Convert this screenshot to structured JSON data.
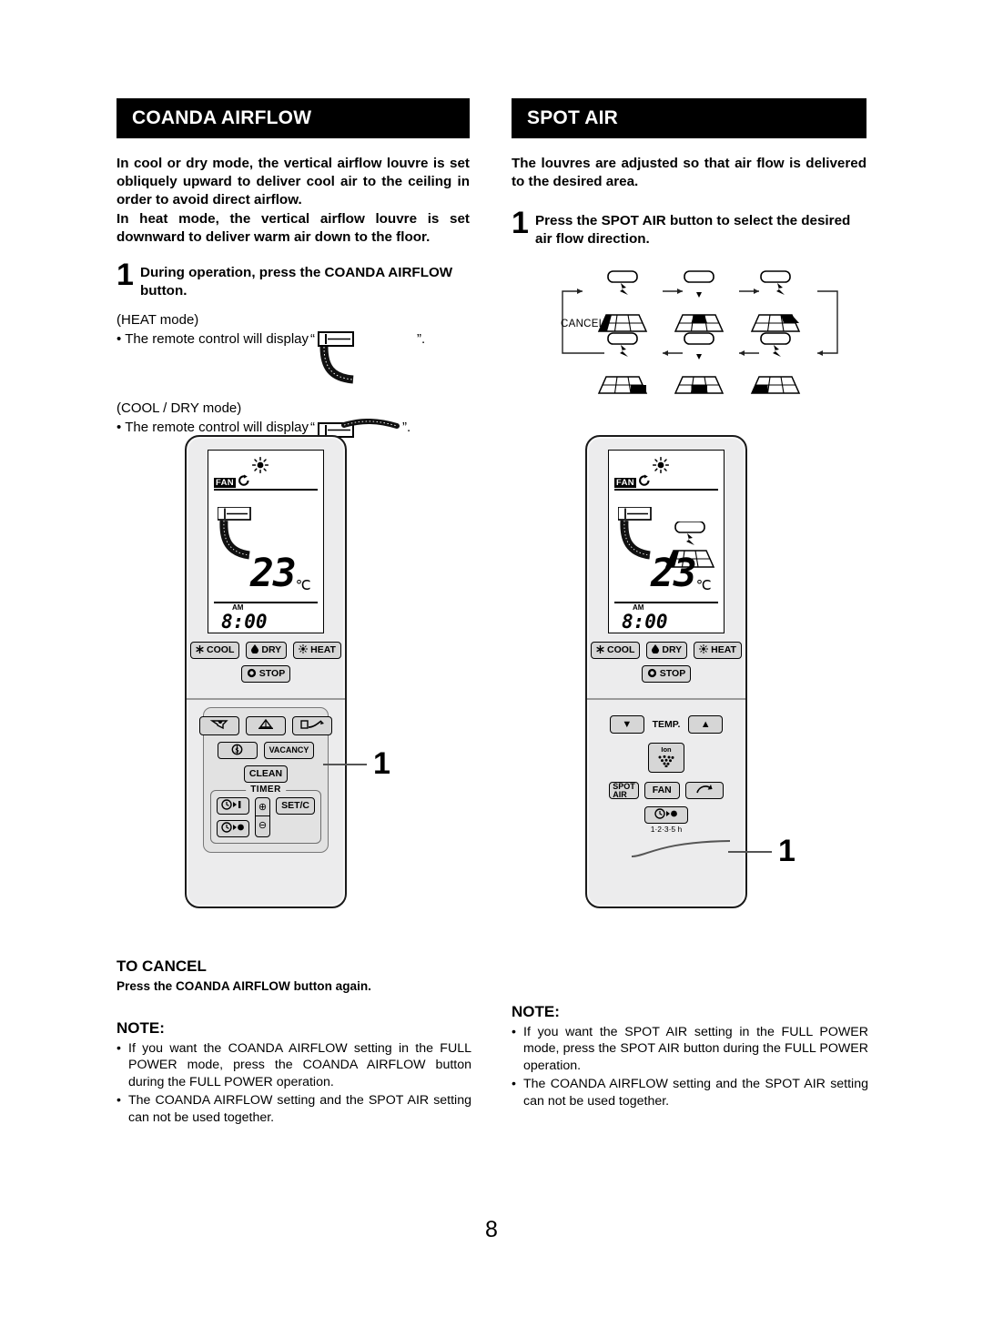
{
  "page": {
    "number": "8"
  },
  "left": {
    "header": "COANDA AIRFLOW",
    "intro": [
      "In cool or dry mode, the vertical airflow louvre is set obliquely upward to deliver cool air to the ceiling in order to avoid direct airflow.",
      "In heat mode, the vertical airflow louvre is set downward to deliver warm air down to the floor."
    ],
    "step": {
      "number": "1",
      "text": "During operation, press the COANDA AIRFLOW button."
    },
    "modes": [
      {
        "label": "(HEAT mode)",
        "bullet": "•",
        "sentence": "The remote control will display",
        "open_quote": "“",
        "close_quote": "”.",
        "icon": "coanda-heat-icon"
      },
      {
        "label": "(COOL / DRY mode)",
        "bullet": "•",
        "sentence": "The remote control will display",
        "open_quote": "“",
        "close_quote": "”.",
        "icon": "coanda-cool-icon"
      }
    ],
    "callout_number": "1",
    "to_cancel": {
      "title": "TO CANCEL",
      "text": "Press the COANDA AIRFLOW button again."
    },
    "note": {
      "title": "NOTE:",
      "items": [
        "If you want the COANDA AIRFLOW setting in the FULL POWER mode, press the COANDA AIRFLOW button during the FULL POWER operation.",
        "The COANDA AIRFLOW setting and the SPOT AIR setting can not be used together."
      ],
      "bullet": "•"
    }
  },
  "right": {
    "header": "SPOT AIR",
    "intro": [
      "The louvres are adjusted so that air flow is delivered to the desired area."
    ],
    "step": {
      "number": "1",
      "text": "Press the SPOT AIR button to select the desired air flow direction."
    },
    "cycle": {
      "cancel_label": "CANCEL",
      "positions": [
        {
          "name": "spot-left-front",
          "cell": 0
        },
        {
          "name": "spot-center-front",
          "cell": 1
        },
        {
          "name": "spot-right-front",
          "cell": 2
        },
        {
          "name": "spot-left-rear",
          "cell": 3
        },
        {
          "name": "spot-center-rear",
          "cell": 4
        },
        {
          "name": "spot-right-rear",
          "cell": 5
        }
      ]
    },
    "callout_number": "1",
    "note": {
      "title": "NOTE:",
      "items": [
        "If you want the SPOT AIR setting in the FULL POWER mode, press the SPOT AIR button during the FULL POWER operation.",
        "The COANDA AIRFLOW setting and the SPOT AIR setting can not be used together."
      ],
      "bullet": "•"
    }
  },
  "remote_left": {
    "display": {
      "fan_label": "FAN",
      "temperature": "23",
      "temperature_unit": "℃",
      "meridiem": "AM",
      "clock": "8:00"
    },
    "mode_buttons": [
      {
        "label": "COOL",
        "icon": "snowflake-icon"
      },
      {
        "label": "DRY",
        "icon": "droplet-icon"
      },
      {
        "label": "HEAT",
        "icon": "sun-icon"
      }
    ],
    "stop_button": {
      "label": "STOP",
      "icon": "stop-circle-icon"
    },
    "function_row": [
      {
        "name": "full-power-button",
        "icon": "full-power-icon"
      },
      {
        "name": "ion-spot-button",
        "icon": "louvre-icon"
      },
      {
        "name": "coanda-airflow-button",
        "icon": "coanda-icon"
      }
    ],
    "economy_button": {
      "icon": "dollar-icon"
    },
    "vacancy_button": {
      "label": "VACANCY"
    },
    "clean_button": {
      "label": "CLEAN"
    },
    "timer": {
      "legend": "TIMER",
      "on_button": {
        "icon": "timer-on-icon"
      },
      "off_button": {
        "icon": "timer-off-icon"
      },
      "plus": "⊕",
      "minus": "⊖",
      "set_button": {
        "label": "SET/C"
      }
    }
  },
  "remote_right": {
    "display": {
      "fan_label": "FAN",
      "temperature": "23",
      "temperature_unit": "℃",
      "meridiem": "AM",
      "clock": "8:00"
    },
    "mode_buttons": [
      {
        "label": "COOL",
        "icon": "snowflake-icon"
      },
      {
        "label": "DRY",
        "icon": "droplet-icon"
      },
      {
        "label": "HEAT",
        "icon": "sun-icon"
      }
    ],
    "stop_button": {
      "label": "STOP",
      "icon": "stop-circle-icon"
    },
    "temp": {
      "label": "TEMP.",
      "down": "▼",
      "up": "▲"
    },
    "ion_button": {
      "label": "Ion",
      "icon": "ion-icon"
    },
    "spot_air_button": {
      "label": "SPOT AIR"
    },
    "fan_button": {
      "label": "FAN"
    },
    "swing_button": {
      "icon": "swing-icon"
    },
    "timer_button": {
      "icon": "timer-off-icon",
      "caption": "1·2·3·5 h"
    }
  }
}
